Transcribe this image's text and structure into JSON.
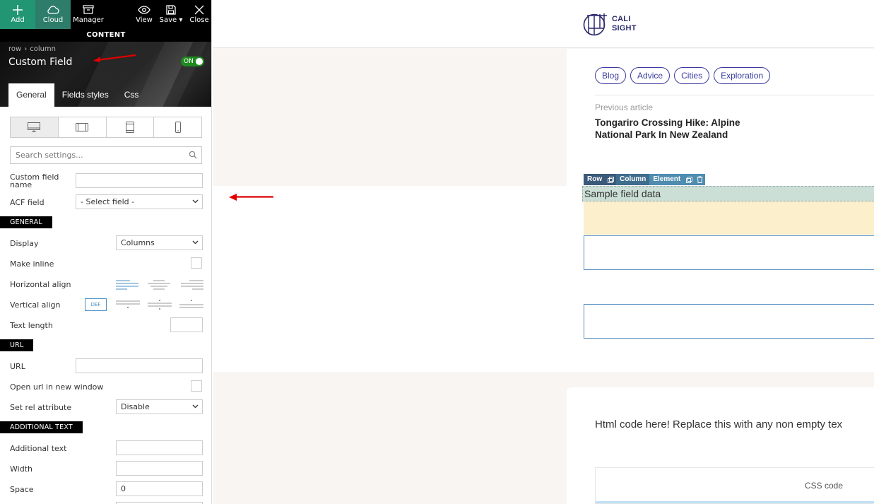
{
  "toolbar": {
    "add": "Add",
    "cloud": "Cloud",
    "manager": "Manager",
    "view": "View",
    "save": "Save",
    "close": "Close",
    "content_bar": "CONTENT"
  },
  "header": {
    "breadcrumb": [
      "row",
      "column"
    ],
    "title": "Custom Field",
    "toggle": "ON"
  },
  "tabs": [
    "General",
    "Fields styles",
    "Css"
  ],
  "devices": [
    "desktop-icon",
    "tablet-landscape-icon",
    "tablet-portrait-icon",
    "mobile-icon"
  ],
  "search": {
    "placeholder": "Search settings..."
  },
  "fields": {
    "custom_field_name": {
      "label": "Custom field name",
      "value": ""
    },
    "acf_field": {
      "label": "ACF field",
      "value": "- Select field -"
    }
  },
  "sections": {
    "general": "GENERAL",
    "url": "URL",
    "additional_text": "ADDITIONAL TEXT"
  },
  "general": {
    "display": {
      "label": "Display",
      "value": "Columns"
    },
    "make_inline": {
      "label": "Make inline"
    },
    "horizontal_align": {
      "label": "Horizontal align"
    },
    "vertical_align": {
      "label": "Vertical align",
      "def": "DEF"
    },
    "text_length": {
      "label": "Text length",
      "value": ""
    }
  },
  "url": {
    "url": {
      "label": "URL",
      "value": ""
    },
    "new_window": {
      "label": "Open url in new window"
    },
    "rel": {
      "label": "Set rel attribute",
      "value": "Disable"
    }
  },
  "additional": {
    "text": {
      "label": "Additional text",
      "value": ""
    },
    "width": {
      "label": "Width",
      "value": ""
    },
    "space": {
      "label": "Space",
      "value": "0"
    }
  },
  "canvas": {
    "logo": {
      "line1": "CALI",
      "line2": "SIGHT"
    },
    "tags": [
      "Blog",
      "Advice",
      "Cities",
      "Exploration"
    ],
    "prev_label": "Previous article",
    "prev_title": "Tongariro Crossing Hike: Alpine National Park In New Zealand",
    "edit_bar": {
      "row": "Row",
      "column": "Column",
      "element": "Element"
    },
    "sample": "Sample field data",
    "html_text": "Html code here! Replace this with any non empty tex",
    "css_label": "CSS code"
  },
  "colors": {
    "add_green": "#229673",
    "toggle_green": "#1f8a1f",
    "tag_blue": "#3a3aa0",
    "annotation_red": "#e00000"
  }
}
